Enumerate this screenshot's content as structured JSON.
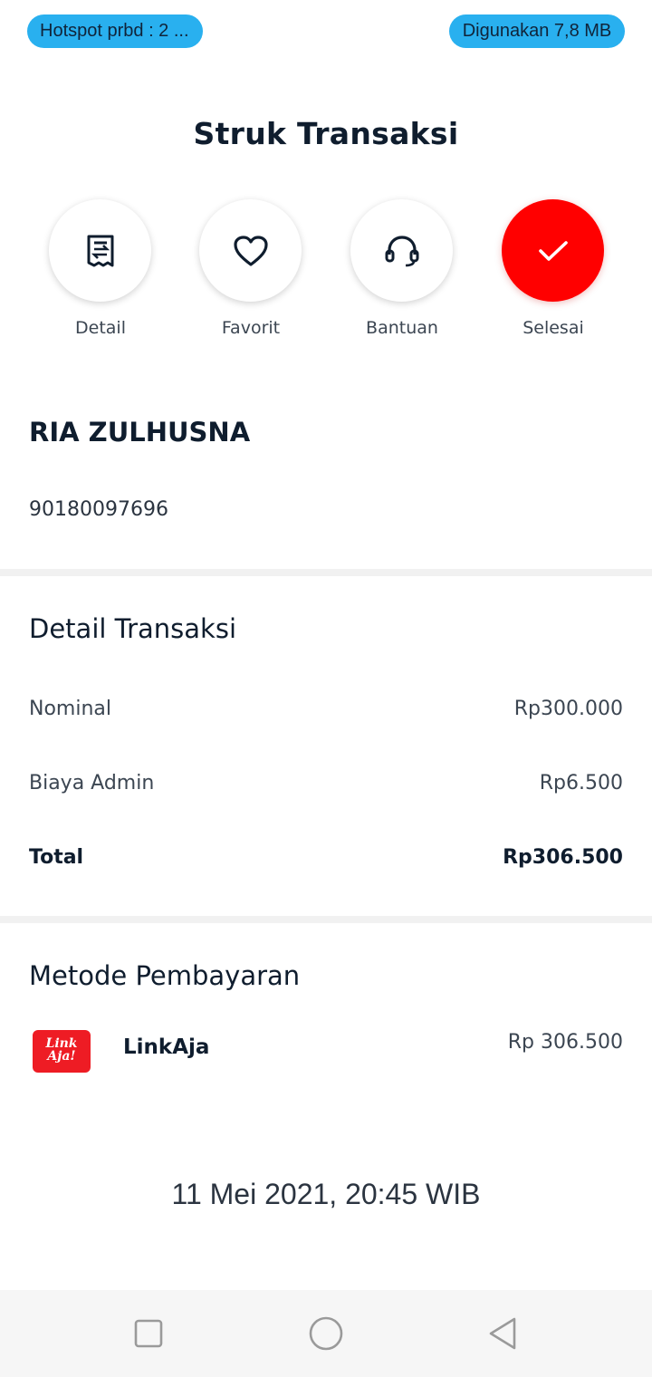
{
  "status_bar": {
    "hotspot": "Hotspot prbd : 2 ...",
    "usage": "Digunakan 7,8 MB"
  },
  "page_title": "Struk Transaksi",
  "actions": [
    {
      "label": "Detail",
      "icon": "receipt-icon"
    },
    {
      "label": "Favorit",
      "icon": "heart-icon"
    },
    {
      "label": "Bantuan",
      "icon": "headset-icon"
    },
    {
      "label": "Selesai",
      "icon": "check-icon"
    }
  ],
  "recipient": {
    "name": "RIA ZULHUSNA",
    "account": "90180097696"
  },
  "details": {
    "title": "Detail Transaksi",
    "rows": [
      {
        "label": "Nominal",
        "value": "Rp300.000"
      },
      {
        "label": "Biaya Admin",
        "value": "Rp6.500"
      },
      {
        "label": "Total",
        "value": "Rp306.500"
      }
    ]
  },
  "payment": {
    "title": "Metode Pembayaran",
    "logo_text_1": "Link",
    "logo_text_2": "Aja!",
    "method": "LinkAja",
    "amount": "Rp 306.500"
  },
  "datetime": "11 Mei 2021, 20:45 WIB",
  "colors": {
    "accent_red": "#ff0000",
    "pill_blue": "#29b0ef",
    "linkaja_red": "#ee1c24"
  },
  "nav_buttons": [
    "recent-apps-icon",
    "home-icon",
    "back-icon"
  ]
}
